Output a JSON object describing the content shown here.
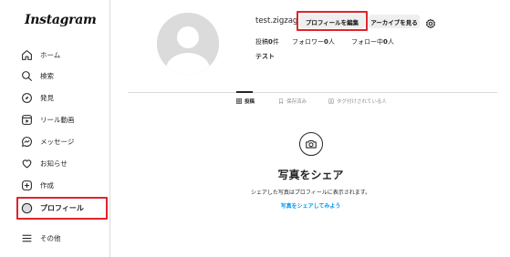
{
  "logo": "Instagram",
  "sidebar": {
    "items": [
      {
        "label": "ホーム",
        "icon": "home-icon"
      },
      {
        "label": "検索",
        "icon": "search-icon"
      },
      {
        "label": "発見",
        "icon": "compass-icon"
      },
      {
        "label": "リール動画",
        "icon": "reels-icon"
      },
      {
        "label": "メッセージ",
        "icon": "messenger-icon"
      },
      {
        "label": "お知らせ",
        "icon": "heart-icon"
      },
      {
        "label": "作成",
        "icon": "plus-square-icon"
      },
      {
        "label": "プロフィール",
        "icon": "profile-icon"
      },
      {
        "label": "その他",
        "icon": "menu-icon"
      }
    ]
  },
  "profile": {
    "username": "test.zigzag",
    "edit_button": "プロフィールを編集",
    "archive_button": "アーカイブを見る",
    "posts_label": "投稿",
    "posts_count": "0",
    "posts_unit": "件",
    "followers_label": "フォロワー",
    "followers_count": "0",
    "followers_unit": "人",
    "following_label": "フォロー中",
    "following_count": "0",
    "following_unit": "人",
    "display_name": "テスト"
  },
  "tabs": [
    {
      "label": "投稿",
      "icon": "grid-icon"
    },
    {
      "label": "保存済み",
      "icon": "bookmark-icon"
    },
    {
      "label": "タグ付けされている人",
      "icon": "tag-icon"
    }
  ],
  "empty_state": {
    "title": "写真をシェア",
    "subtitle": "シェアした写真はプロフィールに表示されます。",
    "link": "写真をシェアしてみよう"
  },
  "colors": {
    "highlight": "#e0232b",
    "link": "#0095f6",
    "button_bg": "#efefef",
    "border": "#dbdbdb"
  }
}
